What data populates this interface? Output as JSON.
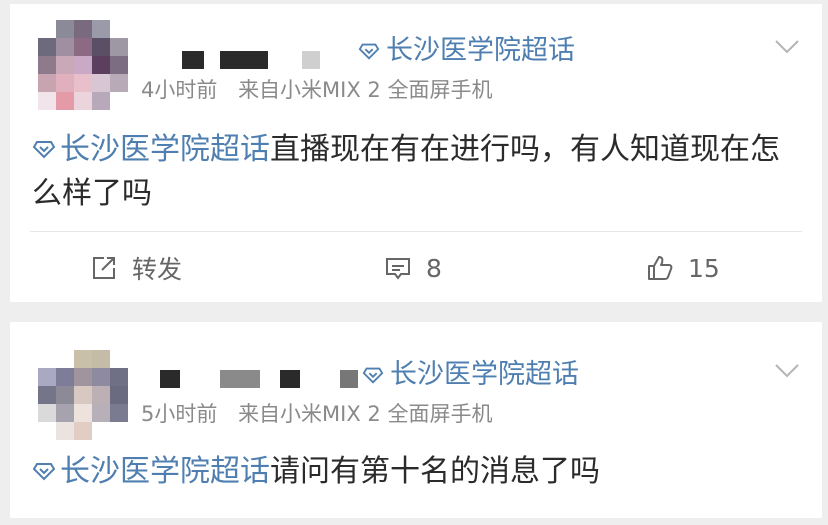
{
  "posts": [
    {
      "topic": "长沙医学院超话",
      "time": "4小时前",
      "source": "来自小米MIX 2 全面屏手机",
      "text_topic": "长沙医学院超话",
      "text_body": "直播现在有在进行吗，有人知道现在怎么样了吗",
      "actions": {
        "repost_label": "转发",
        "comment_count": "8",
        "like_count": "15"
      }
    },
    {
      "topic": "长沙医学院超话",
      "time": "5小时前",
      "source": "来自小米MIX 2 全面屏手机",
      "text_topic": "长沙医学院超话",
      "text_body": "请问有第十名的消息了吗"
    }
  ],
  "colors": {
    "topic": "#4f7fb0",
    "meta": "#8a8a8a",
    "text": "#2b2b2b",
    "background": "#eeeeee"
  },
  "icons": [
    "super-topic-diamond-icon",
    "chevron-down-icon",
    "repost-icon",
    "comment-icon",
    "like-icon"
  ]
}
